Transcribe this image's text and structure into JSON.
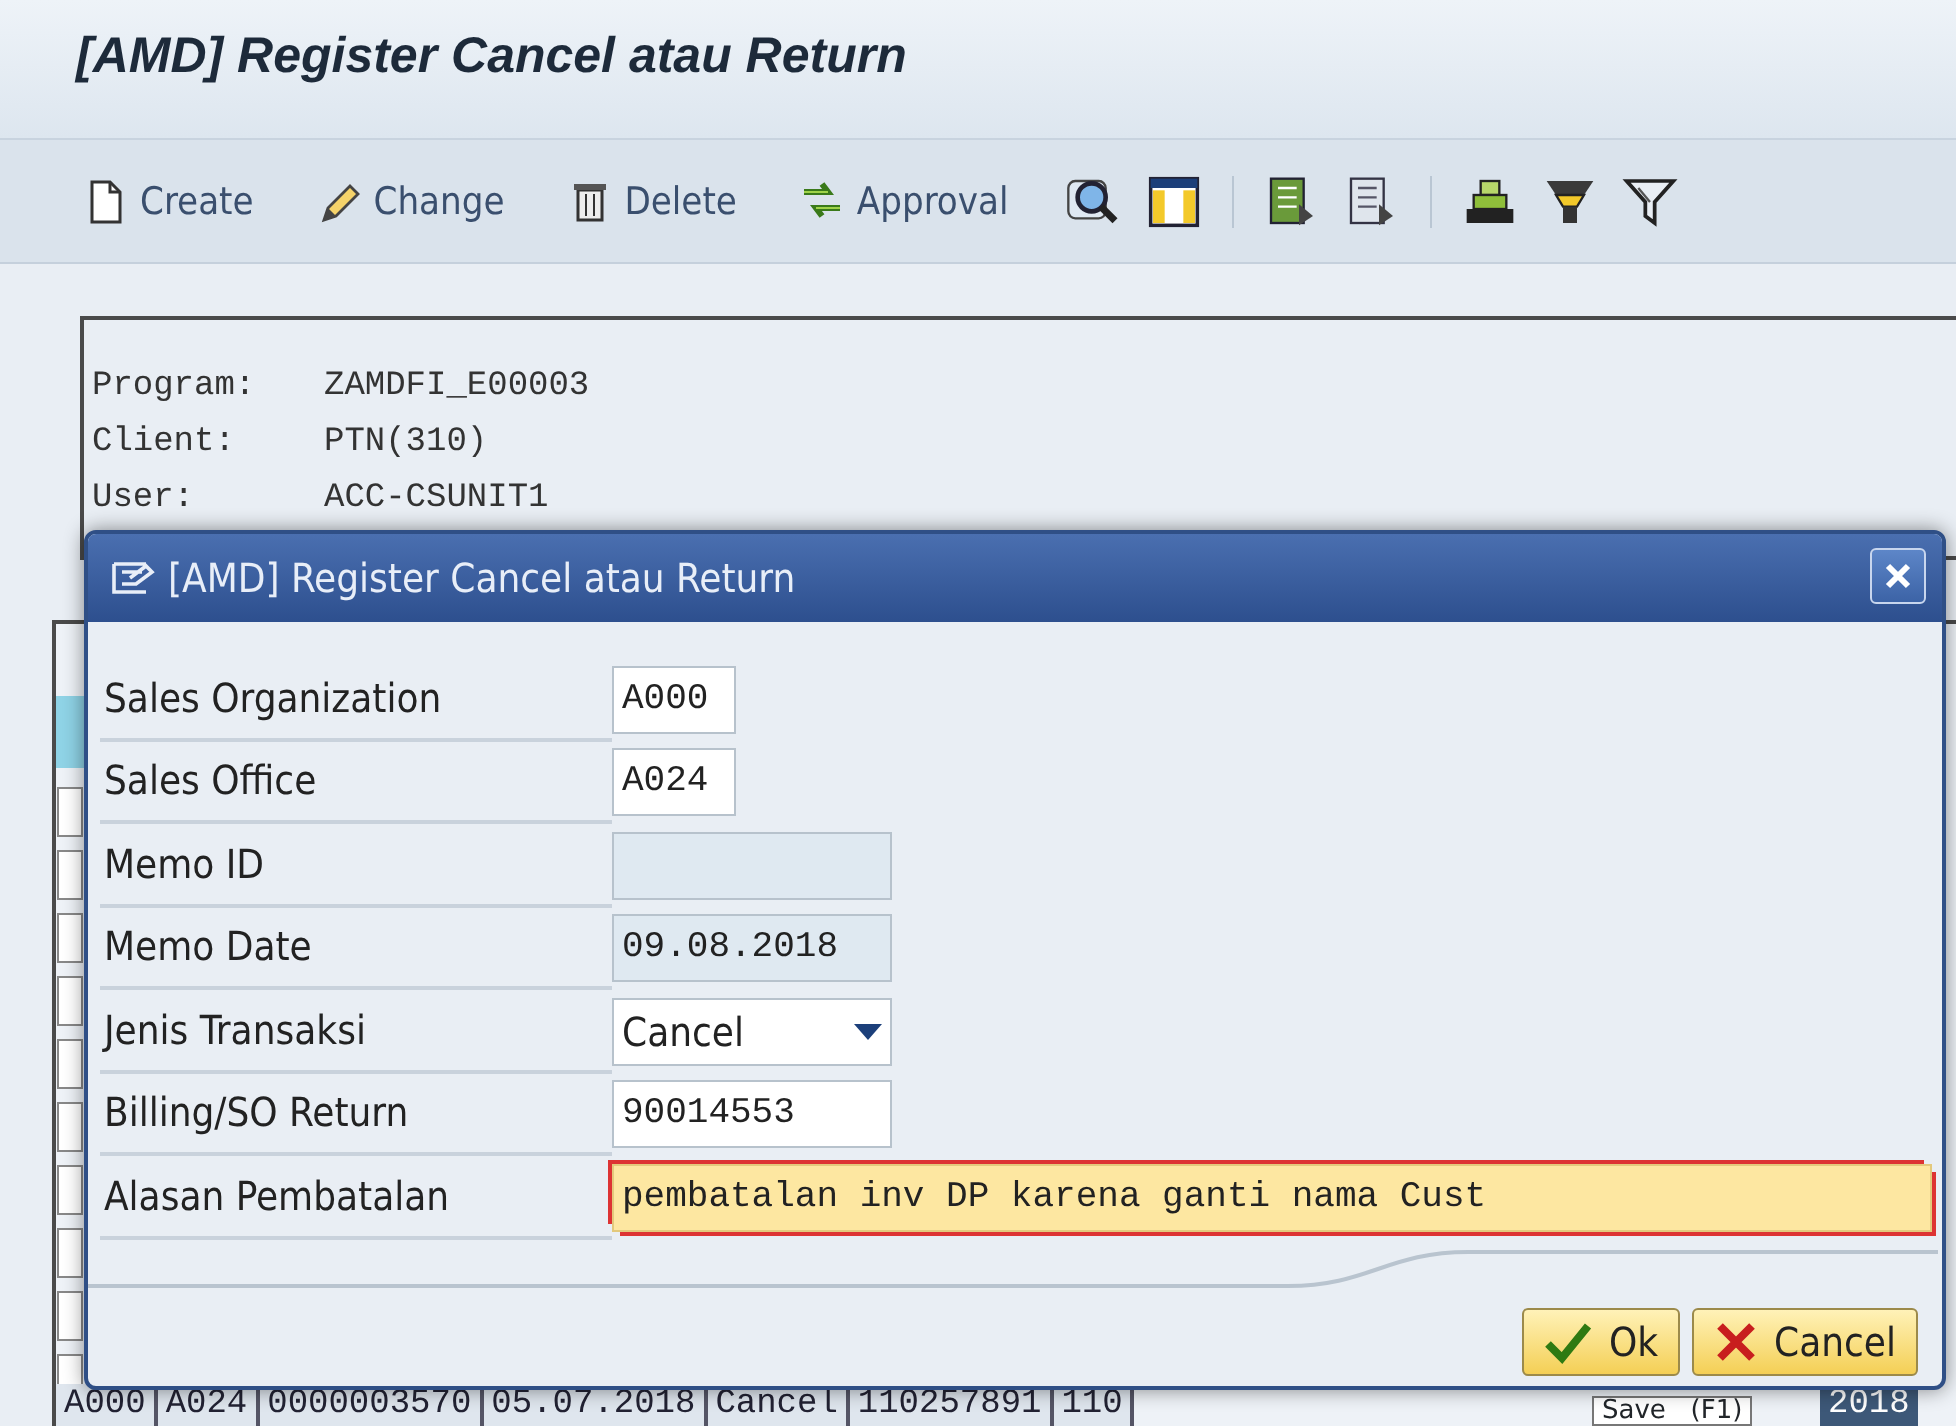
{
  "window": {
    "title": "[AMD] Register Cancel atau Return"
  },
  "toolbar": [
    {
      "kind": "text",
      "label": "Create"
    },
    {
      "kind": "text",
      "label": "Change"
    },
    {
      "kind": "text",
      "label": "Delete"
    },
    {
      "kind": "text",
      "label": "Approval"
    },
    {
      "kind": "icon"
    },
    {
      "kind": "icon"
    },
    {
      "kind": "separator"
    },
    {
      "kind": "icon"
    },
    {
      "kind": "icon"
    },
    {
      "kind": "separator"
    },
    {
      "kind": "icon"
    },
    {
      "kind": "icon"
    },
    {
      "kind": "icon"
    }
  ],
  "info": [
    {
      "key": "Program:",
      "value": "ZAMDFI_E00003"
    },
    {
      "key": "Client:",
      "value": "PTN(310)"
    },
    {
      "key": "User:",
      "value": "ACC-CSUNIT1"
    }
  ],
  "table": {
    "rows": [
      [
        "A000",
        "A024",
        "0000003570",
        "05.07.2018",
        "Cancel",
        "110257891",
        "110"
      ]
    ],
    "tooltip": "Save   (F1)",
    "trailing_cell": "2018"
  },
  "dialog": {
    "title": "[AMD] Register Cancel atau Return",
    "fields": [
      {
        "label": "Sales Organization",
        "value": "A000",
        "kind": "short",
        "focused": false
      },
      {
        "label": "Sales Office",
        "value": "A024",
        "kind": "short",
        "focused": false
      },
      {
        "label": "Memo ID",
        "kind": "display",
        "focused": false
      },
      {
        "label": "Memo Date",
        "value": "09.08.2018",
        "kind": "display",
        "focused": false
      },
      {
        "label": "Jenis Transaksi",
        "value": "Cancel",
        "kind": "dropdown",
        "focused": false
      },
      {
        "label": "Billing/SO Return",
        "value": "90014553",
        "kind": "input",
        "focused": false
      },
      {
        "label": "Alasan Pembatalan",
        "value": "pembatalan inv DP karena ganti nama Cust",
        "kind": "long",
        "focused": true
      }
    ],
    "buttons": [
      {
        "label": "Ok",
        "kind": "ok"
      },
      {
        "label": "Cancel",
        "kind": "cancel"
      }
    ]
  }
}
